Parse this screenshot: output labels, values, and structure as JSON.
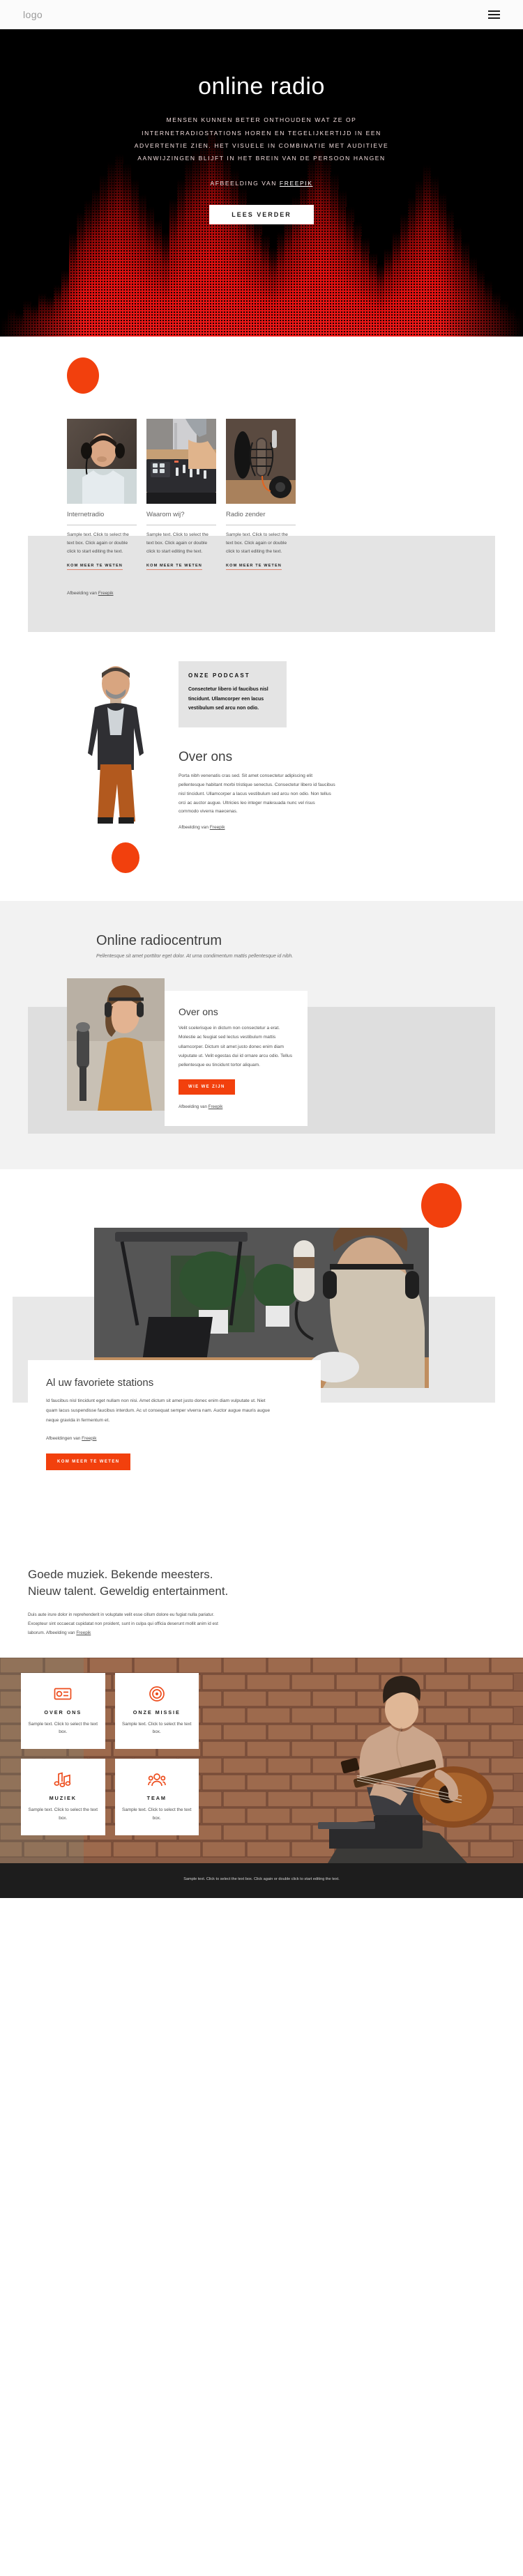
{
  "header": {
    "logo": "logo",
    "menu_icon": "hamburger-menu"
  },
  "hero": {
    "title": "online radio",
    "subtitle": "MENSEN KUNNEN BETER ONTHOUDEN WAT ZE OP INTERNETRADIOSTATIONS HOREN EN TEGELIJKERTIJD IN EEN ADVERTENTIE ZIEN. HET VISUELE IN COMBINATIE MET AUDITIEVE AANWIJZINGEN BLIJFT IN HET BREIN VAN DE PERSOON HANGEN",
    "credit_prefix": "AFBEELDING VAN ",
    "credit_link": "FREEPIK",
    "button": "LEES VERDER"
  },
  "cards": {
    "items": [
      {
        "title": "Internetradio",
        "text": "Sample text. Click to select the text box. Click again or double click to start editing the text.",
        "link": "KOM MEER TE WETEN"
      },
      {
        "title": "Waarom wij?",
        "text": "Sample text. Click to select the text box. Click again or double click to start editing the text.",
        "link": "KOM MEER TE WETEN"
      },
      {
        "title": "Radio zender",
        "text": "Sample text. Click to select the text box. Click again or double click to start editing the text.",
        "link": "KOM MEER TE WETEN"
      }
    ],
    "credit_prefix": "Afbeelding van ",
    "credit_link": "Freepik"
  },
  "about": {
    "podcast_title": "ONZE PODCAST",
    "podcast_text": "Consectetur libero id faucibus nisl tincidunt. Ullamcorper een lacus vestibulum sed arcu non odio.",
    "heading": "Over ons",
    "paragraph": "Porta nibh venenatis cras sed. Sit amet consectetur adipiscing elit pellentesque habitant morbi tristique senectus. Consectetur libero id faucibus nisl tincidunt. Ullamcorper a lacus vestibulum sed arcu non odio. Non tellus orci ac auctor augue. Ultricies leo integer malesuada nunc vel risus commodo viverra maecenas.",
    "credit_prefix": "Afbeelding van ",
    "credit_link": "Freepik"
  },
  "center": {
    "heading": "Online radiocentrum",
    "subheading": "Pellentesque sit amet porttitor eget dolor. At urna condimentum mattis pellentesque id nibh.",
    "card_title": "Over ons",
    "card_text": "Velit scelerisque in dictum non consectetur a erat. Molestie ac feugiat sed lectus vestibulum mattis ullamcorper. Dictum sit amet justo donec enim diam vulputate ut. Velit egestas dui id ornare arcu odio. Tellus pellentesque eu tincidunt tortor aliquam.",
    "button": "WIE WE ZIJN",
    "credit_prefix": "Afbeelding van ",
    "credit_link": "Freepik"
  },
  "stations": {
    "heading": "Al uw favoriete stations",
    "paragraph": "Id faucibus nisl tincidunt eget nullam non nisi. Amet dictum sit amet justo donec enim diam vulputate ut. Niet quam lacus suspendisse faucibus interdum. Ac ut consequat semper viverra nam. Auctor augue mauris augue neque gravida in fermentum et.",
    "credit_prefix": "Afbeeldingen van ",
    "credit_link": "Freepik",
    "button": "KOM MEER TE WETEN"
  },
  "music": {
    "heading": "Goede muziek. Bekende meesters. Nieuw talent. Geweldig entertainment.",
    "paragraph": "Duis aute irure dolor in reprehenderit in voluptate velit esse cillum dolore eu fugiat nulla pariatur. Excepteur sint occaecat cupidatat non proident, sunt in culpa qui officia deserunt mollit anim id est laborum. Afbeelding van ",
    "paragraph_link": "Freepik",
    "features": [
      {
        "icon": "radio-icon",
        "title": "OVER ONS",
        "text": "Sample text. Click to select the text box."
      },
      {
        "icon": "target-icon",
        "title": "ONZE MISSIE",
        "text": "Sample text. Click to select the text box."
      },
      {
        "icon": "music-note-icon",
        "title": "MUZIEK",
        "text": "Sample text. Click to select the text box."
      },
      {
        "icon": "team-icon",
        "title": "TEAM",
        "text": "Sample text. Click to select the text box."
      }
    ]
  },
  "footer": {
    "text": "Sample text. Click to select the text box. Click again or double click to start editing the text."
  },
  "colors": {
    "accent": "#f2400d",
    "hero_red": "#e01010",
    "dark": "#1d1d1d",
    "gray_band": "#e4e4e4"
  }
}
